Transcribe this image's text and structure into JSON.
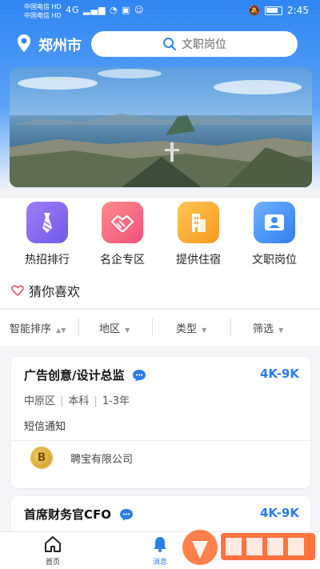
{
  "status_bar": {
    "carrier1": "中国电信 HD",
    "carrier2": "中国电信 HD",
    "signal": "4G",
    "time": "2:45"
  },
  "header": {
    "city": "郑州市",
    "search_placeholder": "文职岗位"
  },
  "categories": [
    {
      "label": "热招排行",
      "icon": "necktie-icon",
      "color": "#8e6ff0"
    },
    {
      "label": "名企专区",
      "icon": "handshake-icon",
      "color": "#f0607e"
    },
    {
      "label": "提供住宿",
      "icon": "building-icon",
      "color": "#f5a524"
    },
    {
      "label": "文职岗位",
      "icon": "user-card-icon",
      "color": "#3f8ef5"
    }
  ],
  "section": {
    "title": "猜你喜欢"
  },
  "filters": [
    {
      "label": "智能排序"
    },
    {
      "label": "地区"
    },
    {
      "label": "类型"
    },
    {
      "label": "筛选"
    }
  ],
  "jobs": [
    {
      "title": "广告创意/设计总监",
      "salary": "4K-9K",
      "district": "中原区",
      "education": "本科",
      "experience": "1-3年",
      "note": "短信通知",
      "company": "聘宝有限公司"
    },
    {
      "title": "首席财务官CFO",
      "salary": "4K-9K"
    }
  ],
  "tabbar": {
    "home": "首页",
    "messages": "消息"
  }
}
